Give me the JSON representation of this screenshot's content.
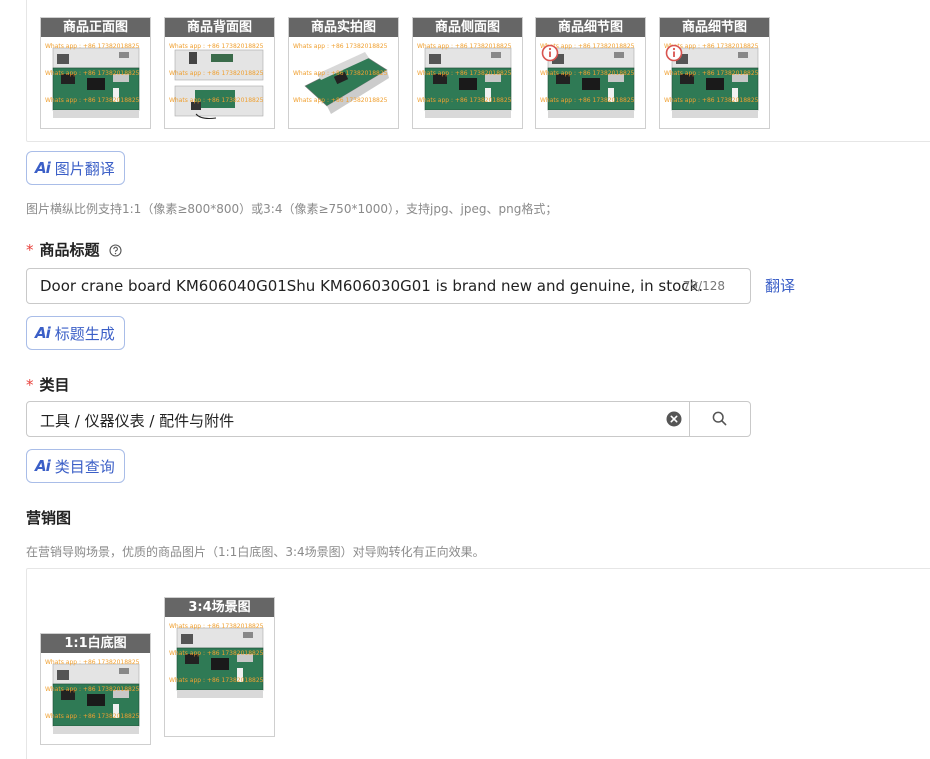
{
  "images": {
    "thumbnails": [
      {
        "caption": "商品正面图"
      },
      {
        "caption": "商品背面图"
      },
      {
        "caption": "商品实拍图"
      },
      {
        "caption": "商品侧面图"
      },
      {
        "caption": "商品细节图"
      },
      {
        "caption": "商品细节图"
      }
    ],
    "watermark_line1": "Whats app : +86 17382018825",
    "translate_button": "图片翻译",
    "hint": "图片横纵比例支持1:1（像素≥800*800）或3:4（像素≥750*1000），支持jpg、jpeg、png格式；"
  },
  "title_field": {
    "label": "商品标题",
    "value": "Door crane board KM606040G01Shu KM606030G01 is brand new and genuine, in stock.",
    "counter": "79/128",
    "translate_link": "翻译",
    "generate_button": "标题生成"
  },
  "category_field": {
    "label": "类目",
    "value": "工具 / 仪器仪表 / 配件与附件",
    "query_button": "类目查询"
  },
  "marketing": {
    "label": "营销图",
    "hint": "在营销导购场景，优质的商品图片（1:1白底图、3:4场景图）对导购转化有正向效果。",
    "images": [
      {
        "caption": "1:1白底图"
      },
      {
        "caption": "3:4场景图"
      }
    ]
  },
  "colors": {
    "accent": "#3b5fc7",
    "required": "#e8413c",
    "caption_bg": "#666666"
  }
}
